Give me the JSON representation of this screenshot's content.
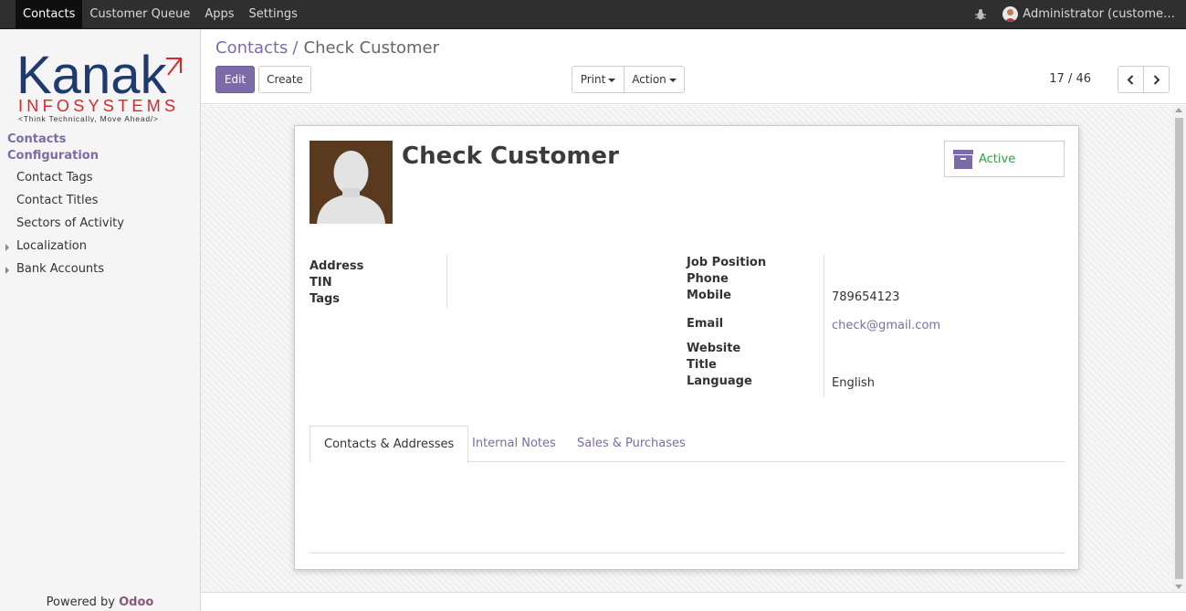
{
  "topbar": {
    "menu": [
      "Contacts",
      "Customer Queue",
      "Apps",
      "Settings"
    ],
    "user": "Administrator (custome…"
  },
  "sidebar": {
    "logo": {
      "name": "Kanak",
      "sub": "INFOSYSTEMS",
      "tagline": "<Think Technically, Move Ahead/>"
    },
    "headers": [
      "Contacts",
      "Configuration"
    ],
    "items": [
      "Contact Tags",
      "Contact Titles",
      "Sectors of Activity",
      "Localization",
      "Bank Accounts"
    ],
    "powered_prefix": "Powered by",
    "powered_brand": "Odoo"
  },
  "breadcrumb": {
    "parent": "Contacts",
    "separator": "/",
    "current": "Check Customer"
  },
  "buttons": {
    "edit": "Edit",
    "create": "Create",
    "print": "Print",
    "action": "Action"
  },
  "pager": {
    "text": "17 / 46"
  },
  "record": {
    "name": "Check Customer",
    "status": "Active",
    "labels_left": [
      "Address",
      "TIN",
      "Tags"
    ],
    "labels_right": {
      "job": "Job Position",
      "phone": "Phone",
      "mobile": "Mobile",
      "email": "Email",
      "website": "Website",
      "title": "Title",
      "language": "Language"
    },
    "values": {
      "mobile": "789654123",
      "email": "check@gmail.com",
      "language": "English"
    }
  },
  "tabs": [
    "Contacts & Addresses",
    "Internal Notes",
    "Sales & Purchases"
  ],
  "colors": {
    "accent": "#7c6ba8",
    "active_green": "#28a745",
    "topbar": "#2f2f2f"
  }
}
